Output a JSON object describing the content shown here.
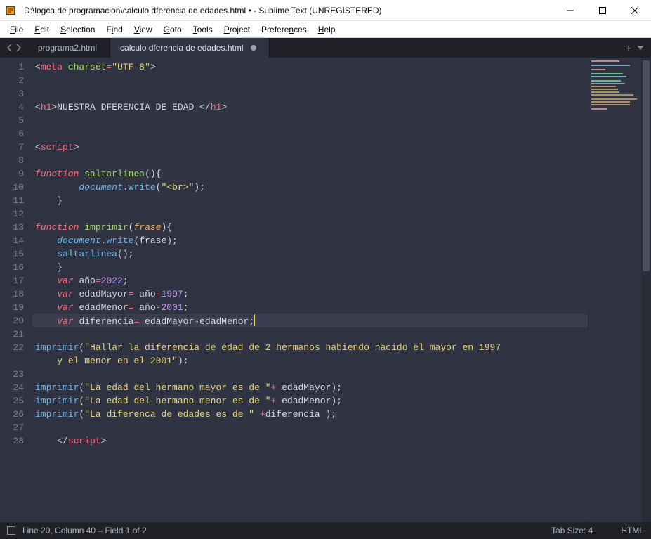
{
  "window": {
    "title": "D:\\logca de programacion\\calculo dferencia de edades.html • - Sublime Text (UNREGISTERED)"
  },
  "menu": {
    "file": "File",
    "edit": "Edit",
    "selection": "Selection",
    "find": "Find",
    "view": "View",
    "goto": "Goto",
    "tools": "Tools",
    "project": "Project",
    "preferences": "Preferences",
    "help": "Help"
  },
  "tabs": {
    "tab0": "programa2.html",
    "tab1": "calculo dferencia de edades.html"
  },
  "status": {
    "position": "Line 20, Column 40 – Field 1 of 2",
    "tabsize": "Tab Size: 4",
    "syntax": "HTML"
  },
  "code": {
    "l1": {
      "tag": "meta",
      "attr": "charset",
      "eq": "=",
      "str": "\"UTF-8\""
    },
    "l4": {
      "open": "h1",
      "text": "NUESTRA DFERENCIA DE EDAD ",
      "close": "h1"
    },
    "l7": {
      "tag": "script"
    },
    "l9": {
      "kw": "function",
      "name": "saltarlinea",
      "paren": "(){"
    },
    "l10": {
      "obj": "document",
      "dot": ".",
      "call": "write",
      "open": "(",
      "str": "\"<br>\"",
      "close": ");"
    },
    "l11": {
      "brace": "}"
    },
    "l13": {
      "kw": "function",
      "name": "imprimir",
      "open": "(",
      "param": "frase",
      "close": "){"
    },
    "l14": {
      "obj": "document",
      "dot": ".",
      "call": "write",
      "open": "(",
      "arg": "frase",
      "close": ");"
    },
    "l15": {
      "call": "saltarlinea",
      "rest": "();"
    },
    "l16": {
      "brace": "}"
    },
    "l17": {
      "kw": "var",
      "name": "año",
      "eq": "=",
      "num": "2022",
      "semi": ";"
    },
    "l18": {
      "kw": "var",
      "name": "edadMayor",
      "eq": "= ",
      "rhs1": "año",
      "op": "-",
      "num": "1997",
      "semi": ";"
    },
    "l19": {
      "kw": "var",
      "name": "edadMenor",
      "eq": "= ",
      "rhs1": "año",
      "op": "-",
      "num": "2001",
      "semi": ";"
    },
    "l20": {
      "kw": "var",
      "name": "diferencia",
      "eq": "= ",
      "a": "edadMayor",
      "op": "-",
      "b": "edadMenor",
      "semi": ";"
    },
    "l22": {
      "call": "imprimir",
      "open": "(",
      "str": "\"Hallar la diferencia de edad de 2 hermanos habiendo nacido el mayor en 1997 ",
      "cont": "y el menor en el 2001\"",
      "close": ");"
    },
    "l24": {
      "call": "imprimir",
      "open": "(",
      "str": "\"La edad del hermano mayor es de \"",
      "plus": "+ ",
      "var": "edadMayor",
      "close": ");"
    },
    "l25": {
      "call": "imprimir",
      "open": "(",
      "str": "\"La edad del hermano menor es de \"",
      "plus": "+ ",
      "var": "edadMenor",
      "close": ");"
    },
    "l26": {
      "call": "imprimir",
      "open": "(",
      "str": "\"La diferenca de edades es de \"",
      "plus": " +",
      "var": "diferencia ",
      "close": ");"
    },
    "l28": {
      "tag": "script"
    }
  },
  "line_numbers": [
    "1",
    "2",
    "3",
    "4",
    "5",
    "6",
    "7",
    "8",
    "9",
    "10",
    "11",
    "12",
    "13",
    "14",
    "15",
    "16",
    "17",
    "18",
    "19",
    "20",
    "21",
    "22",
    "",
    "23",
    "24",
    "25",
    "26",
    "27",
    "28"
  ]
}
